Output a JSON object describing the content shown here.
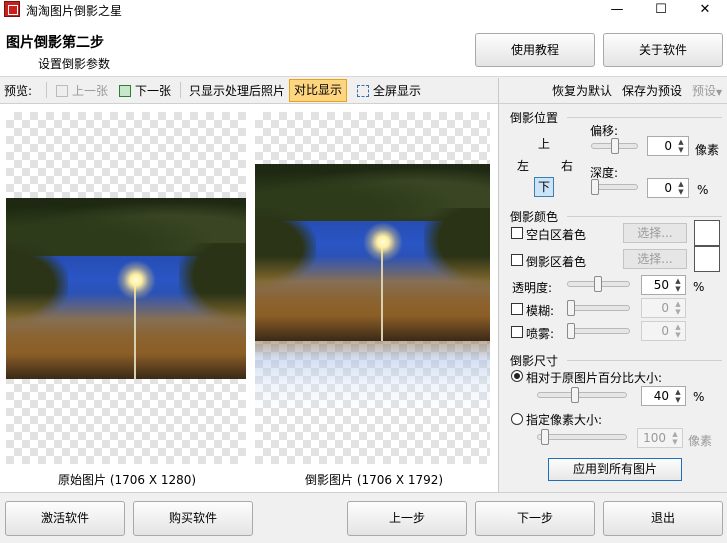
{
  "window": {
    "title": "淘淘图片倒影之星",
    "minimize": "—",
    "maximize": "☐",
    "close": "✕"
  },
  "header": {
    "title": "图片倒影第二步",
    "subtitle": "设置倒影参数",
    "tutorial_button": "使用教程",
    "about_button": "关于软件"
  },
  "toolbar": {
    "preview_label": "预览:",
    "prev_image": "上一张",
    "next_image": "下一张",
    "show_processed": "只显示处理后照片",
    "compare_view": "对比显示",
    "fullscreen": "全屏显示",
    "restore_default": "恢复为默认",
    "save_preset": "保存为预设",
    "preset_menu": "预设"
  },
  "preview": {
    "original_caption": "原始图片 (1706 X 1280)",
    "reflection_caption": "倒影图片 (1706 X 1792)"
  },
  "reflection_position": {
    "title": "倒影位置",
    "up": "上",
    "left": "左",
    "right": "右",
    "down": "下",
    "selected": "下",
    "offset_label": "偏移:",
    "offset_value": "0",
    "offset_unit": "像素",
    "depth_label": "深度:",
    "depth_value": "0",
    "depth_unit": "%"
  },
  "reflection_color": {
    "title": "倒影颜色",
    "blank_tint_label": "空白区着色",
    "reflection_tint_label": "倒影区着色",
    "choose_label": "选择...",
    "transparency_label": "透明度:",
    "transparency_value": "50",
    "transparency_unit": "%",
    "blur_label": "模糊:",
    "blur_value": "0",
    "fog_label": "喷雾:",
    "fog_value": "0"
  },
  "reflection_size": {
    "title": "倒影尺寸",
    "relative_label": "相对于原图片百分比大小:",
    "relative_value": "40",
    "relative_unit": "%",
    "pixel_label": "指定像素大小:",
    "pixel_value": "100",
    "pixel_unit": "像素"
  },
  "apply_button": "应用到所有图片",
  "bottom": {
    "activate": "激活软件",
    "buy": "购买软件",
    "prev_step": "上一步",
    "next_step": "下一步",
    "exit": "退出"
  },
  "colors": {
    "toggle_active": "#ffd680",
    "apply_border": "#1f6fb9"
  }
}
